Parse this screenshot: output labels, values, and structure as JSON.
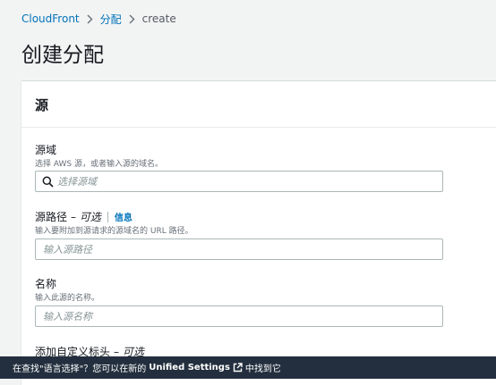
{
  "breadcrumb": {
    "items": [
      {
        "label": "CloudFront"
      },
      {
        "label": "分配"
      },
      {
        "label": "create"
      }
    ]
  },
  "page": {
    "title": "创建分配"
  },
  "origin_section": {
    "title": "源",
    "domain": {
      "label": "源域",
      "description": "选择 AWS 源，或者输入源的域名。",
      "placeholder": "选择源域"
    },
    "path": {
      "label": "源路径",
      "optional": "– 可选",
      "info": "信息",
      "description": "输入要附加到源请求的源域名的 URL 路径。",
      "placeholder": "输入源路径"
    },
    "name": {
      "label": "名称",
      "description": "输入此源的名称。",
      "placeholder": "输入源名称"
    },
    "custom_headers": {
      "label": "添加自定义标头",
      "optional": "– 可选"
    }
  },
  "banner": {
    "prefix": "在查找\"语言选择\"？您可以在新的",
    "link": "Unified Settings",
    "suffix": "中找到它"
  },
  "colors": {
    "link": "#0073bb",
    "banner_bg": "#232f3e",
    "page_bg": "#f2f3f3"
  },
  "icons": [
    "chevron-right-icon",
    "search-icon",
    "external-link-icon"
  ]
}
